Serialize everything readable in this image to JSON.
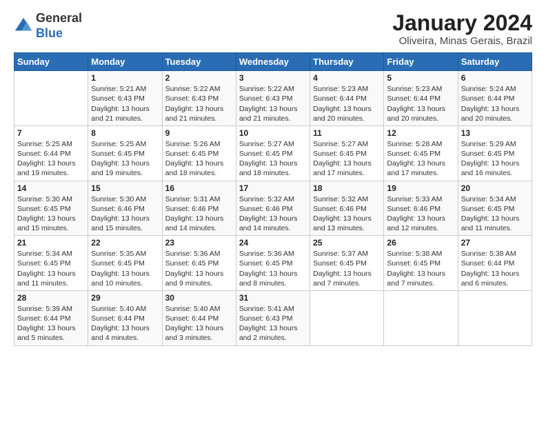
{
  "header": {
    "logo_general": "General",
    "logo_blue": "Blue",
    "month_year": "January 2024",
    "location": "Oliveira, Minas Gerais, Brazil"
  },
  "days_of_week": [
    "Sunday",
    "Monday",
    "Tuesday",
    "Wednesday",
    "Thursday",
    "Friday",
    "Saturday"
  ],
  "weeks": [
    [
      {
        "day": "",
        "info": ""
      },
      {
        "day": "1",
        "info": "Sunrise: 5:21 AM\nSunset: 6:43 PM\nDaylight: 13 hours\nand 21 minutes."
      },
      {
        "day": "2",
        "info": "Sunrise: 5:22 AM\nSunset: 6:43 PM\nDaylight: 13 hours\nand 21 minutes."
      },
      {
        "day": "3",
        "info": "Sunrise: 5:22 AM\nSunset: 6:43 PM\nDaylight: 13 hours\nand 21 minutes."
      },
      {
        "day": "4",
        "info": "Sunrise: 5:23 AM\nSunset: 6:44 PM\nDaylight: 13 hours\nand 20 minutes."
      },
      {
        "day": "5",
        "info": "Sunrise: 5:23 AM\nSunset: 6:44 PM\nDaylight: 13 hours\nand 20 minutes."
      },
      {
        "day": "6",
        "info": "Sunrise: 5:24 AM\nSunset: 6:44 PM\nDaylight: 13 hours\nand 20 minutes."
      }
    ],
    [
      {
        "day": "7",
        "info": "Sunrise: 5:25 AM\nSunset: 6:44 PM\nDaylight: 13 hours\nand 19 minutes."
      },
      {
        "day": "8",
        "info": "Sunrise: 5:25 AM\nSunset: 6:45 PM\nDaylight: 13 hours\nand 19 minutes."
      },
      {
        "day": "9",
        "info": "Sunrise: 5:26 AM\nSunset: 6:45 PM\nDaylight: 13 hours\nand 18 minutes."
      },
      {
        "day": "10",
        "info": "Sunrise: 5:27 AM\nSunset: 6:45 PM\nDaylight: 13 hours\nand 18 minutes."
      },
      {
        "day": "11",
        "info": "Sunrise: 5:27 AM\nSunset: 6:45 PM\nDaylight: 13 hours\nand 17 minutes."
      },
      {
        "day": "12",
        "info": "Sunrise: 5:28 AM\nSunset: 6:45 PM\nDaylight: 13 hours\nand 17 minutes."
      },
      {
        "day": "13",
        "info": "Sunrise: 5:29 AM\nSunset: 6:45 PM\nDaylight: 13 hours\nand 16 minutes."
      }
    ],
    [
      {
        "day": "14",
        "info": "Sunrise: 5:30 AM\nSunset: 6:45 PM\nDaylight: 13 hours\nand 15 minutes."
      },
      {
        "day": "15",
        "info": "Sunrise: 5:30 AM\nSunset: 6:46 PM\nDaylight: 13 hours\nand 15 minutes."
      },
      {
        "day": "16",
        "info": "Sunrise: 5:31 AM\nSunset: 6:46 PM\nDaylight: 13 hours\nand 14 minutes."
      },
      {
        "day": "17",
        "info": "Sunrise: 5:32 AM\nSunset: 6:46 PM\nDaylight: 13 hours\nand 14 minutes."
      },
      {
        "day": "18",
        "info": "Sunrise: 5:32 AM\nSunset: 6:46 PM\nDaylight: 13 hours\nand 13 minutes."
      },
      {
        "day": "19",
        "info": "Sunrise: 5:33 AM\nSunset: 6:46 PM\nDaylight: 13 hours\nand 12 minutes."
      },
      {
        "day": "20",
        "info": "Sunrise: 5:34 AM\nSunset: 6:45 PM\nDaylight: 13 hours\nand 11 minutes."
      }
    ],
    [
      {
        "day": "21",
        "info": "Sunrise: 5:34 AM\nSunset: 6:45 PM\nDaylight: 13 hours\nand 11 minutes."
      },
      {
        "day": "22",
        "info": "Sunrise: 5:35 AM\nSunset: 6:45 PM\nDaylight: 13 hours\nand 10 minutes."
      },
      {
        "day": "23",
        "info": "Sunrise: 5:36 AM\nSunset: 6:45 PM\nDaylight: 13 hours\nand 9 minutes."
      },
      {
        "day": "24",
        "info": "Sunrise: 5:36 AM\nSunset: 6:45 PM\nDaylight: 13 hours\nand 8 minutes."
      },
      {
        "day": "25",
        "info": "Sunrise: 5:37 AM\nSunset: 6:45 PM\nDaylight: 13 hours\nand 7 minutes."
      },
      {
        "day": "26",
        "info": "Sunrise: 5:38 AM\nSunset: 6:45 PM\nDaylight: 13 hours\nand 7 minutes."
      },
      {
        "day": "27",
        "info": "Sunrise: 5:38 AM\nSunset: 6:44 PM\nDaylight: 13 hours\nand 6 minutes."
      }
    ],
    [
      {
        "day": "28",
        "info": "Sunrise: 5:39 AM\nSunset: 6:44 PM\nDaylight: 13 hours\nand 5 minutes."
      },
      {
        "day": "29",
        "info": "Sunrise: 5:40 AM\nSunset: 6:44 PM\nDaylight: 13 hours\nand 4 minutes."
      },
      {
        "day": "30",
        "info": "Sunrise: 5:40 AM\nSunset: 6:44 PM\nDaylight: 13 hours\nand 3 minutes."
      },
      {
        "day": "31",
        "info": "Sunrise: 5:41 AM\nSunset: 6:43 PM\nDaylight: 13 hours\nand 2 minutes."
      },
      {
        "day": "",
        "info": ""
      },
      {
        "day": "",
        "info": ""
      },
      {
        "day": "",
        "info": ""
      }
    ]
  ]
}
